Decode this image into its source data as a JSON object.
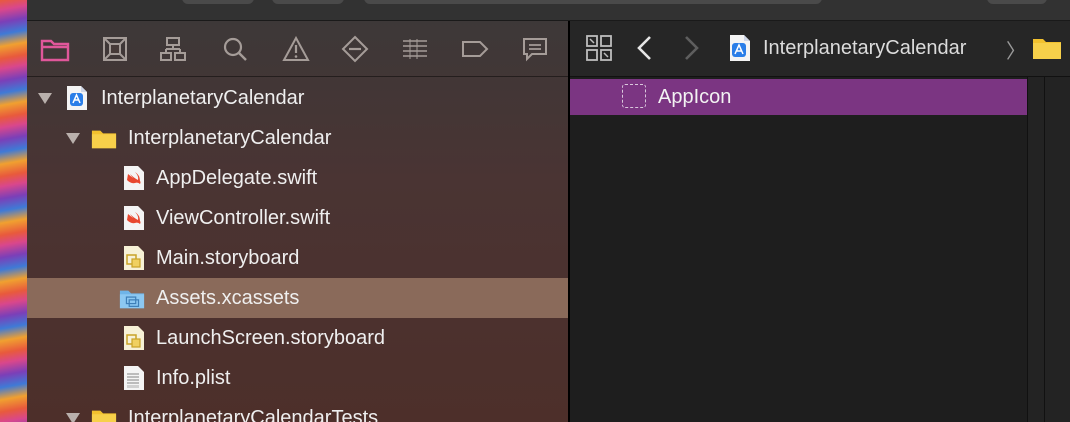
{
  "navigator": {
    "tree": [
      {
        "label": "InterplanetaryCalendar",
        "kind": "project",
        "level": 0,
        "expanded": true
      },
      {
        "label": "InterplanetaryCalendar",
        "kind": "folder",
        "level": 1,
        "expanded": true
      },
      {
        "label": "AppDelegate.swift",
        "kind": "swift",
        "level": 2
      },
      {
        "label": "ViewController.swift",
        "kind": "swift",
        "level": 2
      },
      {
        "label": "Main.storyboard",
        "kind": "storyboard",
        "level": 2
      },
      {
        "label": "Assets.xcassets",
        "kind": "xcassets",
        "level": 2,
        "selected": true
      },
      {
        "label": "LaunchScreen.storyboard",
        "kind": "storyboard",
        "level": 2
      },
      {
        "label": "Info.plist",
        "kind": "plist",
        "level": 2
      },
      {
        "label": "InterplanetaryCalendarTests",
        "kind": "folder",
        "level": 1,
        "expanded": true
      }
    ]
  },
  "jumpbar": {
    "project_label": "InterplanetaryCalendar",
    "separator": "〉"
  },
  "editor": {
    "asset_label": "AppIcon"
  },
  "colors": {
    "selection": "#8a6a5a",
    "asset_selection": "#7b3582",
    "active_tab": "#e0579a"
  }
}
